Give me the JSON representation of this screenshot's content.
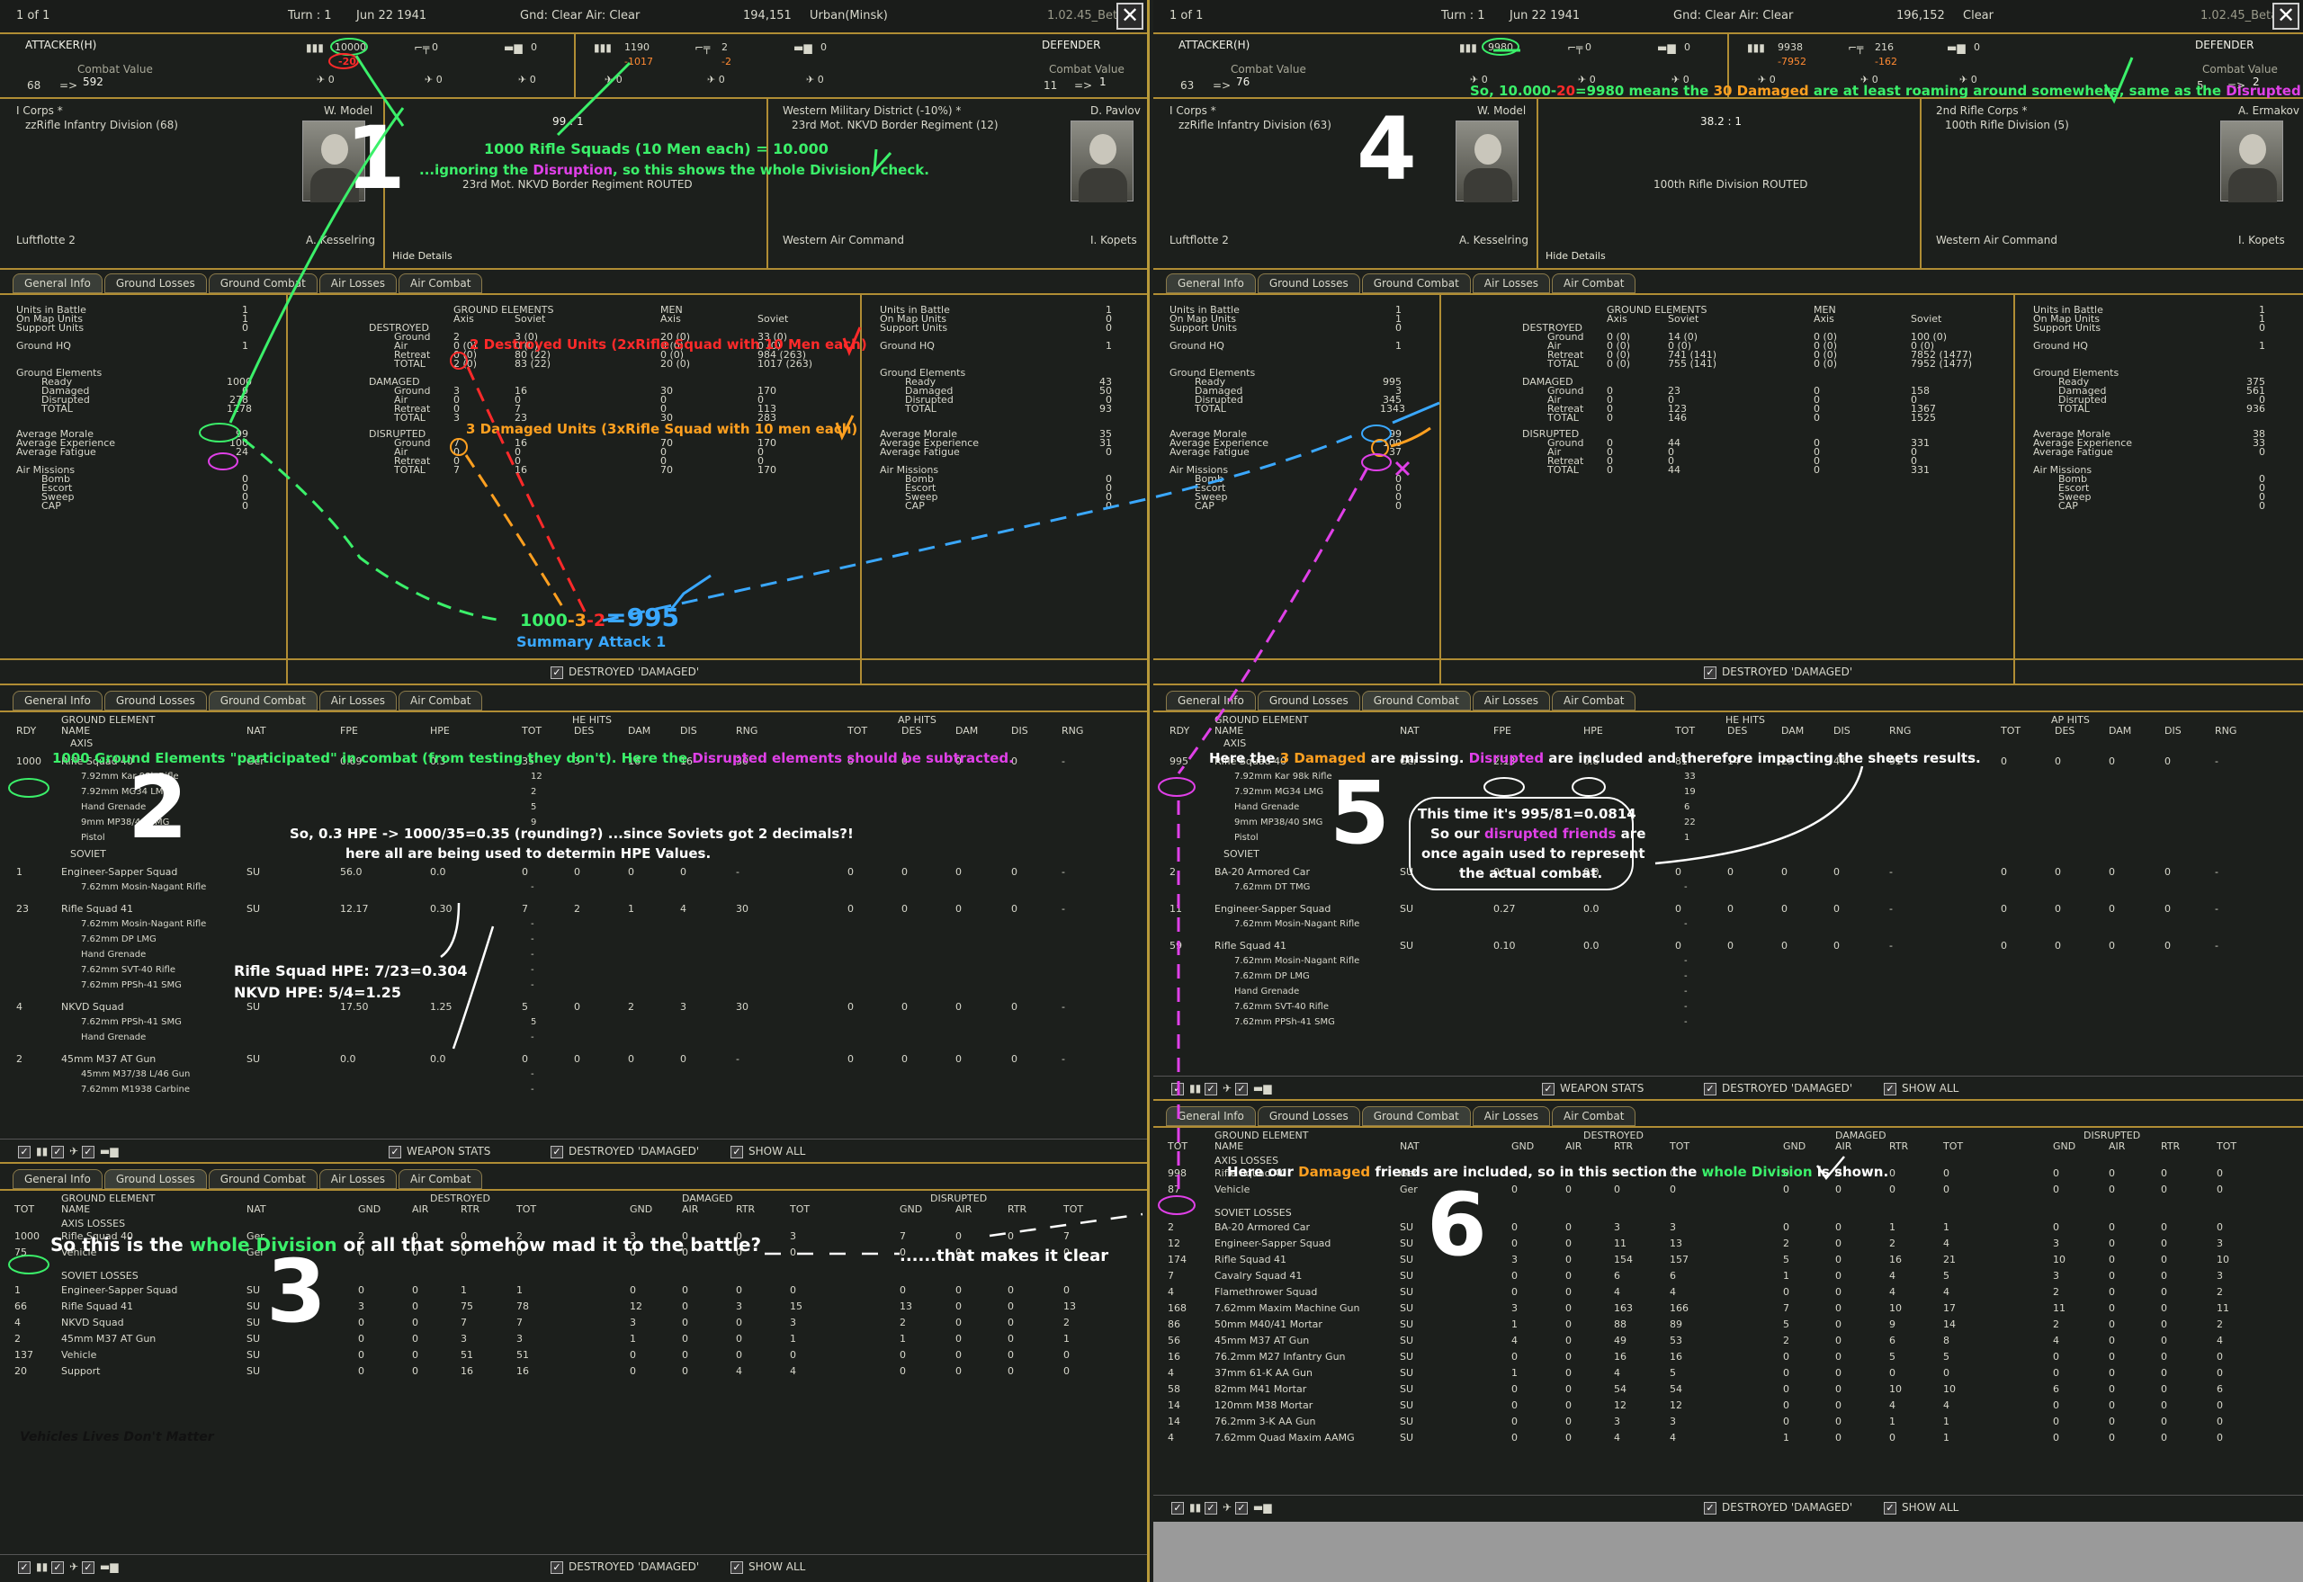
{
  "left": {
    "top": {
      "page": "1 of 1",
      "turn": "Turn : 1",
      "date": "Jun 22 1941",
      "weather": "Gnd: Clear  Air: Clear",
      "coords": "194,151",
      "terrain": "Urban(Minsk)",
      "version": "1.02.45_Beta"
    },
    "attacker": {
      "label": "ATTACKER(H)",
      "cv_label": "Combat Value",
      "cv_from": "68",
      "cv_to": "592",
      "men": "10000",
      "men_loss": "-20",
      "air": "0",
      "tank": "0",
      "row2a": "0",
      "row2b": "0",
      "row2c": "0"
    },
    "defender": {
      "label": "DEFENDER",
      "cv_label": "Combat Value",
      "cv_from": "11",
      "cv_to": "1",
      "men": "1190",
      "men_loss": "-1017",
      "guns": "2",
      "guns_loss": "-2",
      "tank": "0",
      "row2a": "0",
      "row2b": "0",
      "row2c": "0"
    },
    "att_corps": "I Corps *",
    "att_div": "zzRifle Infantry Division (68)",
    "att_leader": "W. Model",
    "att_air": "Luftflotte 2",
    "att_air_leader": "A. Kesselring",
    "odds": "99 : 1",
    "routed": "23rd Mot. NKVD Border Regiment ROUTED",
    "hide": "Hide Details",
    "def_district": "Western Military District (-10%) *",
    "def_unit": "23rd Mot. NKVD Border Regiment (12)",
    "def_leader": "D. Pavlov",
    "def_air": "Western Air Command",
    "def_air_leader": "I. Kopets"
  },
  "right": {
    "top": {
      "page": "1 of 1",
      "turn": "Turn : 1",
      "date": "Jun 22 1941",
      "weather": "Gnd: Clear  Air: Clear",
      "coords": "196,152",
      "terrain": "Clear",
      "version": "1.02.45_Beta"
    },
    "attacker": {
      "label": "ATTACKER(H)",
      "cv_label": "Combat Value",
      "cv_from": "63",
      "cv_to": "76",
      "men": "9980",
      "air": "0",
      "tank": "0",
      "row2a": "0",
      "row2b": "0",
      "row2c": "0"
    },
    "defender": {
      "label": "DEFENDER",
      "cv_label": "Combat Value",
      "cv_from": "5",
      "cv_to": "2",
      "men": "9938",
      "men_loss": "-7952",
      "guns": "216",
      "guns_loss": "-162",
      "tank": "0",
      "row2a": "0",
      "row2b": "0",
      "row2c": "0"
    },
    "att_corps": "I Corps *",
    "att_div": "zzRifle Infantry Division (63)",
    "att_leader": "W. Model",
    "att_air": "Luftflotte 2",
    "att_air_leader": "A. Kesselring",
    "odds": "38.2 : 1",
    "routed": "100th Rifle Division ROUTED",
    "hide": "Hide Details",
    "def_corps": "2nd Rifle Corps *",
    "def_unit": "100th Rifle Division (5)",
    "def_leader": "A. Ermakov",
    "def_air": "Western Air Command",
    "def_air_leader": "I. Kopets"
  },
  "tabs": [
    "General Info",
    "Ground Losses",
    "Ground Combat",
    "Air Losses",
    "Air Combat"
  ],
  "gi_left_labels": [
    "Units in Battle",
    "On Map Units",
    "Support Units",
    "Ground HQ",
    "Ground Elements",
    "Ready",
    "Damaged",
    "Disrupted",
    "TOTAL",
    "Average Morale",
    "Average Experience",
    "Average Fatigue",
    "Air Missions",
    "Bomb",
    "Escort",
    "Sweep",
    "CAP"
  ],
  "gi_L_att": [
    "1",
    "1",
    "0",
    "1",
    "",
    "1000",
    "0",
    "278",
    "1278",
    "99",
    "100",
    "24",
    "",
    "0",
    "0",
    "0",
    "0"
  ],
  "gi_L_def": [
    "1",
    "0",
    "0",
    "1",
    "",
    "43",
    "50",
    "0",
    "93",
    "35",
    "31",
    "0",
    "",
    "0",
    "0",
    "0",
    "0"
  ],
  "gi_R_att": [
    "1",
    "1",
    "0",
    "1",
    "",
    "995",
    "3",
    "345",
    "1343",
    "99",
    "100",
    "37",
    "",
    "0",
    "0",
    "0",
    "0"
  ],
  "gi_R_def": [
    "1",
    "1",
    "0",
    "1",
    "",
    "375",
    "561",
    "0",
    "936",
    "38",
    "33",
    "0",
    "",
    "0",
    "0",
    "0",
    "0"
  ],
  "ge_hdr": {
    "ground": "GROUND ELEMENTS",
    "men": "MEN",
    "axis": "Axis",
    "soviet": "Soviet"
  },
  "ge_rows": [
    "DESTROYED",
    "Ground",
    "Air",
    "Retreat",
    "TOTAL",
    "DAMAGED",
    "Ground",
    "Air",
    "Retreat",
    "TOTAL",
    "DISRUPTED",
    "Ground",
    "Air",
    "Retreat",
    "TOTAL"
  ],
  "ge_L": [
    [
      "",
      "",
      "",
      ""
    ],
    [
      "2",
      "3 (0)",
      "20 (0)",
      "33 (0)"
    ],
    [
      "0 (0)",
      "0 (0)",
      "0 (0)",
      "0 (0)"
    ],
    [
      "0 (0)",
      "80 (22)",
      "0 (0)",
      "984 (263)"
    ],
    [
      "2 (0)",
      "83 (22)",
      "20 (0)",
      "1017 (263)"
    ],
    [
      "",
      "",
      "",
      ""
    ],
    [
      "3",
      "16",
      "30",
      "170"
    ],
    [
      "0",
      "0",
      "0",
      "0"
    ],
    [
      "0",
      "7",
      "0",
      "113"
    ],
    [
      "3",
      "23",
      "30",
      "283"
    ],
    [
      "",
      "",
      "",
      ""
    ],
    [
      "7",
      "16",
      "70",
      "170"
    ],
    [
      "0",
      "0",
      "0",
      "0"
    ],
    [
      "0",
      "0",
      "0",
      "0"
    ],
    [
      "7",
      "16",
      "70",
      "170"
    ]
  ],
  "ge_R": [
    [
      "",
      "",
      "",
      ""
    ],
    [
      "0 (0)",
      "14 (0)",
      "0 (0)",
      "100 (0)"
    ],
    [
      "0 (0)",
      "0 (0)",
      "0 (0)",
      "0 (0)"
    ],
    [
      "0 (0)",
      "741 (141)",
      "0 (0)",
      "7852 (1477)"
    ],
    [
      "0 (0)",
      "755 (141)",
      "0 (0)",
      "7952 (1477)"
    ],
    [
      "",
      "",
      "",
      ""
    ],
    [
      "0",
      "23",
      "0",
      "158"
    ],
    [
      "0",
      "0",
      "0",
      "0"
    ],
    [
      "0",
      "123",
      "0",
      "1367"
    ],
    [
      "0",
      "146",
      "0",
      "1525"
    ],
    [
      "",
      "",
      "",
      ""
    ],
    [
      "0",
      "44",
      "0",
      "331"
    ],
    [
      "0",
      "0",
      "0",
      "0"
    ],
    [
      "0",
      "0",
      "0",
      "0"
    ],
    [
      "0",
      "44",
      "0",
      "331"
    ]
  ],
  "destroyed_damaged": "DESTROYED 'DAMAGED'",
  "weapon_stats": "WEAPON STATS",
  "show_all": "SHOW ALL",
  "gc_hdr": {
    "rdy": "RDY",
    "ge": "GROUND ELEMENT",
    "name": "NAME",
    "nat": "NAT",
    "fpe": "FPE",
    "hpe": "HPE",
    "he": "HE HITS",
    "ap": "AP HITS",
    "tot": "TOT",
    "des": "DES",
    "dam": "DAM",
    "dis": "DIS",
    "rng": "RNG"
  },
  "gc_L": [
    {
      "rdy": "",
      "name": "AXIS",
      "nat": "",
      "fpe": "",
      "hpe": "",
      "tot": "",
      "des": "",
      "dam": "",
      "dis": "",
      "rng": "",
      "head": true
    },
    {
      "rdy": "1000",
      "name": "Rifle Squad 40",
      "nat": "Ger",
      "fpe": "0.69",
      "hpe": "0.3",
      "tot": "35",
      "des": "3",
      "dam": "16",
      "dis": "16",
      "rng": "30",
      "a": "0",
      "b": "0",
      "c": "0",
      "d": "0",
      "e": "-"
    },
    {
      "rdy": "",
      "name": "7.92mm Kar 98k Rifle",
      "sub": true,
      "tot": "12"
    },
    {
      "rdy": "",
      "name": "7.92mm MG34 LMG",
      "sub": true,
      "tot": "2"
    },
    {
      "rdy": "",
      "name": "Hand Grenade",
      "sub": true,
      "tot": "5"
    },
    {
      "rdy": "",
      "name": "9mm MP38/40 SMG",
      "sub": true,
      "tot": "9"
    },
    {
      "rdy": "",
      "name": "Pistol",
      "sub": true,
      "tot": "7"
    },
    {
      "rdy": "",
      "name": "SOVIET",
      "head": true
    },
    {
      "rdy": "1",
      "name": "Engineer-Sapper Squad",
      "nat": "SU",
      "fpe": "56.0",
      "hpe": "0.0",
      "tot": "0",
      "des": "0",
      "dam": "0",
      "dis": "0",
      "rng": "-",
      "a": "0",
      "b": "0",
      "c": "0",
      "d": "0",
      "e": "-"
    },
    {
      "rdy": "",
      "name": "7.62mm Mosin-Nagant Rifle",
      "sub": true,
      "tot": "-"
    },
    {
      "rdy": "23",
      "name": "Rifle Squad 41",
      "nat": "SU",
      "fpe": "12.17",
      "hpe": "0.30",
      "tot": "7",
      "des": "2",
      "dam": "1",
      "dis": "4",
      "rng": "30",
      "a": "0",
      "b": "0",
      "c": "0",
      "d": "0",
      "e": "-"
    },
    {
      "rdy": "",
      "name": "7.62mm Mosin-Nagant Rifle",
      "sub": true,
      "tot": "-"
    },
    {
      "rdy": "",
      "name": "7.62mm DP LMG",
      "sub": true,
      "tot": "-"
    },
    {
      "rdy": "",
      "name": "Hand Grenade",
      "sub": true,
      "tot": "-"
    },
    {
      "rdy": "",
      "name": "7.62mm SVT-40 Rifle",
      "sub": true,
      "tot": "-"
    },
    {
      "rdy": "",
      "name": "7.62mm PPSh-41 SMG",
      "sub": true,
      "tot": "-"
    },
    {
      "rdy": "4",
      "name": "NKVD Squad",
      "nat": "SU",
      "fpe": "17.50",
      "hpe": "1.25",
      "tot": "5",
      "des": "0",
      "dam": "2",
      "dis": "3",
      "rng": "30",
      "a": "0",
      "b": "0",
      "c": "0",
      "d": "0",
      "e": "-"
    },
    {
      "rdy": "",
      "name": "7.62mm PPSh-41 SMG",
      "sub": true,
      "tot": "5"
    },
    {
      "rdy": "",
      "name": "Hand Grenade",
      "sub": true,
      "tot": "-"
    },
    {
      "rdy": "2",
      "name": "45mm M37 AT Gun",
      "nat": "SU",
      "fpe": "0.0",
      "hpe": "0.0",
      "tot": "0",
      "des": "0",
      "dam": "0",
      "dis": "0",
      "rng": "-",
      "a": "0",
      "b": "0",
      "c": "0",
      "d": "0",
      "e": "-"
    },
    {
      "rdy": "",
      "name": "45mm M37/38 L/46 Gun",
      "sub": true,
      "tot": "-"
    },
    {
      "rdy": "",
      "name": "7.62mm M1938 Carbine",
      "sub": true,
      "tot": "-"
    }
  ],
  "gc_R": [
    {
      "rdy": "",
      "name": "AXIS",
      "head": true
    },
    {
      "rdy": "995",
      "name": "Rifle Squad 40",
      "nat": "Ger",
      "fpe": "2.13",
      "hpe": "0.8",
      "tot": "81",
      "des": "14",
      "dam": "23",
      "dis": "44",
      "rng": "91",
      "a": "0",
      "b": "0",
      "c": "0",
      "d": "0",
      "e": "-"
    },
    {
      "rdy": "",
      "name": "7.92mm Kar 98k Rifle",
      "sub": true,
      "tot": "33"
    },
    {
      "rdy": "",
      "name": "7.92mm MG34 LMG",
      "sub": true,
      "tot": "19"
    },
    {
      "rdy": "",
      "name": "Hand Grenade",
      "sub": true,
      "tot": "6"
    },
    {
      "rdy": "",
      "name": "9mm MP38/40 SMG",
      "sub": true,
      "tot": "22"
    },
    {
      "rdy": "",
      "name": "Pistol",
      "sub": true,
      "tot": "1"
    },
    {
      "rdy": "",
      "name": "SOVIET",
      "head": true
    },
    {
      "rdy": "2",
      "name": "BA-20 Armored Car",
      "nat": "SU",
      "fpe": "0.0",
      "hpe": "0.0",
      "tot": "0",
      "des": "0",
      "dam": "0",
      "dis": "0",
      "rng": "-",
      "a": "0",
      "b": "0",
      "c": "0",
      "d": "0",
      "e": "-"
    },
    {
      "rdy": "",
      "name": "7.62mm DT TMG",
      "sub": true,
      "tot": "-"
    },
    {
      "rdy": "11",
      "name": "Engineer-Sapper Squad",
      "nat": "SU",
      "fpe": "0.27",
      "hpe": "0.0",
      "tot": "0",
      "des": "0",
      "dam": "0",
      "dis": "0",
      "rng": "-",
      "a": "0",
      "b": "0",
      "c": "0",
      "d": "0",
      "e": "-"
    },
    {
      "rdy": "",
      "name": "7.62mm Mosin-Nagant Rifle",
      "sub": true,
      "tot": "-"
    },
    {
      "rdy": "59",
      "name": "Rifle Squad 41",
      "nat": "SU",
      "fpe": "0.10",
      "hpe": "0.0",
      "tot": "0",
      "des": "0",
      "dam": "0",
      "dis": "0",
      "rng": "-",
      "a": "0",
      "b": "0",
      "c": "0",
      "d": "0",
      "e": "-"
    },
    {
      "rdy": "",
      "name": "7.62mm Mosin-Nagant Rifle",
      "sub": true,
      "tot": "-"
    },
    {
      "rdy": "",
      "name": "7.62mm DP LMG",
      "sub": true,
      "tot": "-"
    },
    {
      "rdy": "",
      "name": "Hand Grenade",
      "sub": true,
      "tot": "-"
    },
    {
      "rdy": "",
      "name": "7.62mm SVT-40 Rifle",
      "sub": true,
      "tot": "-"
    },
    {
      "rdy": "",
      "name": "7.62mm PPSh-41 SMG",
      "sub": true,
      "tot": "-"
    }
  ],
  "gl_hdr": {
    "ge": "GROUND ELEMENT",
    "tot": "TOT",
    "name": "NAME",
    "nat": "NAT",
    "destroyed": "DESTROYED",
    "damaged": "DAMAGED",
    "disrupted": "DISRUPTED",
    "gnd": "GND",
    "air": "AIR",
    "rtr": "RTR",
    "tot2": "TOT",
    "axis": "AXIS LOSSES",
    "soviet": "SOVIET LOSSES"
  },
  "gl_L_axis": [
    [
      "1000",
      "Rifle Squad 40",
      "Ger",
      "2",
      "0",
      "0",
      "2",
      "3",
      "0",
      "0",
      "3",
      "7",
      "0",
      "0",
      "7"
    ],
    [
      "75",
      "Vehicle",
      "Ger",
      "0",
      "0",
      "0",
      "0",
      "0",
      "0",
      "0",
      "0",
      "0",
      "0",
      "0",
      "0"
    ]
  ],
  "gl_L_sov": [
    [
      "1",
      "Engineer-Sapper Squad",
      "SU",
      "0",
      "0",
      "1",
      "1",
      "0",
      "0",
      "0",
      "0",
      "0",
      "0",
      "0",
      "0"
    ],
    [
      "66",
      "Rifle Squad 41",
      "SU",
      "3",
      "0",
      "75",
      "78",
      "12",
      "0",
      "3",
      "15",
      "13",
      "0",
      "0",
      "13"
    ],
    [
      "4",
      "NKVD Squad",
      "SU",
      "0",
      "0",
      "7",
      "7",
      "3",
      "0",
      "0",
      "3",
      "2",
      "0",
      "0",
      "2"
    ],
    [
      "2",
      "45mm M37 AT Gun",
      "SU",
      "0",
      "0",
      "3",
      "3",
      "1",
      "0",
      "0",
      "1",
      "1",
      "0",
      "0",
      "1"
    ],
    [
      "137",
      "Vehicle",
      "SU",
      "0",
      "0",
      "51",
      "51",
      "0",
      "0",
      "0",
      "0",
      "0",
      "0",
      "0",
      "0"
    ],
    [
      "20",
      "Support",
      "SU",
      "0",
      "0",
      "16",
      "16",
      "0",
      "0",
      "4",
      "4",
      "0",
      "0",
      "0",
      "0"
    ]
  ],
  "gl_R_axis": [
    [
      "998",
      "Rifle Squad 40",
      "Ger",
      "0",
      "0",
      "0",
      "0",
      "0",
      "0",
      "0",
      "0",
      "0",
      "0",
      "0",
      "0"
    ],
    [
      "87",
      "Vehicle",
      "Ger",
      "0",
      "0",
      "0",
      "0",
      "0",
      "0",
      "0",
      "0",
      "0",
      "0",
      "0",
      "0"
    ]
  ],
  "gl_R_sov": [
    [
      "2",
      "BA-20 Armored Car",
      "SU",
      "0",
      "0",
      "3",
      "3",
      "0",
      "0",
      "1",
      "1",
      "0",
      "0",
      "0",
      "0"
    ],
    [
      "12",
      "Engineer-Sapper Squad",
      "SU",
      "0",
      "0",
      "11",
      "13",
      "2",
      "0",
      "2",
      "4",
      "3",
      "0",
      "0",
      "3"
    ],
    [
      "174",
      "Rifle Squad 41",
      "SU",
      "3",
      "0",
      "154",
      "157",
      "5",
      "0",
      "16",
      "21",
      "10",
      "0",
      "0",
      "10"
    ],
    [
      "7",
      "Cavalry Squad 41",
      "SU",
      "0",
      "0",
      "6",
      "6",
      "1",
      "0",
      "4",
      "5",
      "3",
      "0",
      "0",
      "3"
    ],
    [
      "4",
      "Flamethrower Squad",
      "SU",
      "0",
      "0",
      "4",
      "4",
      "0",
      "0",
      "4",
      "4",
      "2",
      "0",
      "0",
      "2"
    ],
    [
      "168",
      "7.62mm Maxim Machine Gun",
      "SU",
      "3",
      "0",
      "163",
      "166",
      "7",
      "0",
      "10",
      "17",
      "11",
      "0",
      "0",
      "11"
    ],
    [
      "86",
      "50mm M40/41 Mortar",
      "SU",
      "1",
      "0",
      "88",
      "89",
      "5",
      "0",
      "9",
      "14",
      "2",
      "0",
      "0",
      "2"
    ],
    [
      "56",
      "45mm M37 AT Gun",
      "SU",
      "4",
      "0",
      "49",
      "53",
      "2",
      "0",
      "6",
      "8",
      "4",
      "0",
      "0",
      "4"
    ],
    [
      "16",
      "76.2mm M27 Infantry Gun",
      "SU",
      "0",
      "0",
      "16",
      "16",
      "0",
      "0",
      "5",
      "5",
      "0",
      "0",
      "0",
      "0"
    ],
    [
      "4",
      "37mm 61-K AA Gun",
      "SU",
      "1",
      "0",
      "4",
      "5",
      "0",
      "0",
      "0",
      "0",
      "0",
      "0",
      "0",
      "0"
    ],
    [
      "58",
      "82mm M41 Mortar",
      "SU",
      "0",
      "0",
      "54",
      "54",
      "0",
      "0",
      "10",
      "10",
      "6",
      "0",
      "0",
      "6"
    ],
    [
      "14",
      "120mm M38 Mortar",
      "SU",
      "0",
      "0",
      "12",
      "12",
      "0",
      "0",
      "4",
      "4",
      "0",
      "0",
      "0",
      "0"
    ],
    [
      "14",
      "76.2mm 3-K AA Gun",
      "SU",
      "0",
      "0",
      "3",
      "3",
      "0",
      "0",
      "1",
      "1",
      "0",
      "0",
      "0",
      "0"
    ],
    [
      "4",
      "7.62mm Quad Maxim AAMG",
      "SU",
      "0",
      "0",
      "4",
      "4",
      "1",
      "0",
      "0",
      "1",
      "0",
      "0",
      "0",
      "0"
    ]
  ],
  "annot": {
    "n1": "1",
    "n2": "2",
    "n3": "3",
    "n4": "4",
    "n5": "5",
    "n6": "6",
    "a1a": "1000 Rifle Squads (10 Men each) = 10.000",
    "a1b_pre": "...ignoring the ",
    "a1b_hl": "Disruption",
    "a1b_post": ", so this shows the whole Division, check.",
    "destroyed_note": "2 Destroyed Units (2xRifle Squad with 10 Men each)",
    "damaged_note": "3 Damaged Units (3xRifle Squad with 10 men each)",
    "sum_g": "1000",
    "sum_o": "-3",
    "sum_r": "-2",
    "sum_b": "=995",
    "sum_label": "Summary Attack 1",
    "a2a_pre": "1000 Ground Elements \"participated\" in combat (from testing they don't). Here the ",
    "a2a_hl": "Disrupted elements should be subtracted.",
    "a2b": "So, 0.3 HPE -> 1000/35=0.35 (rounding?) ...since Soviets got 2 decimals?!",
    "a2c": "here all are being used to determin HPE Values.",
    "a2d": "Rifle Squad HPE: 7/23=0.304",
    "a2e": "NKVD HPE: 5/4=1.25",
    "a3a_pre": "So this is the ",
    "a3a_hl": "whole Division",
    "a3a_post": " or all that somehow mad it to the battle?",
    "a3b": "......that makes it clear",
    "a3c": "Vehicles Lives Don't Matter",
    "a4_pre": "So, 10.000-",
    "a4_r": "20",
    "a4_mid": "=9980 means the ",
    "a4_o": "30 Damaged",
    "a4_mid2": " are at least roaming around somewhere, same as the ",
    "a4_p": "Disrupted Elements.",
    "a5a_pre": "Here the ",
    "a5a_o": "3 Damaged",
    "a5a_mid": " are missing. ",
    "a5a_p": "Disrupted",
    "a5a_post": " are included and therefore impacting the sheets results.",
    "a5b": "This time it's 995/81=0.0814",
    "a5c_pre": "So our ",
    "a5c_p": "disrupted friends",
    "a5c_post": " are",
    "a5d": "once again used to represent",
    "a5e": "the actual combat.",
    "a6_pre": "Here our ",
    "a6_o": "Damaged",
    "a6_mid": " friends are included, so in this section the ",
    "a6_g": "whole Division",
    "a6_post": " is shown."
  }
}
